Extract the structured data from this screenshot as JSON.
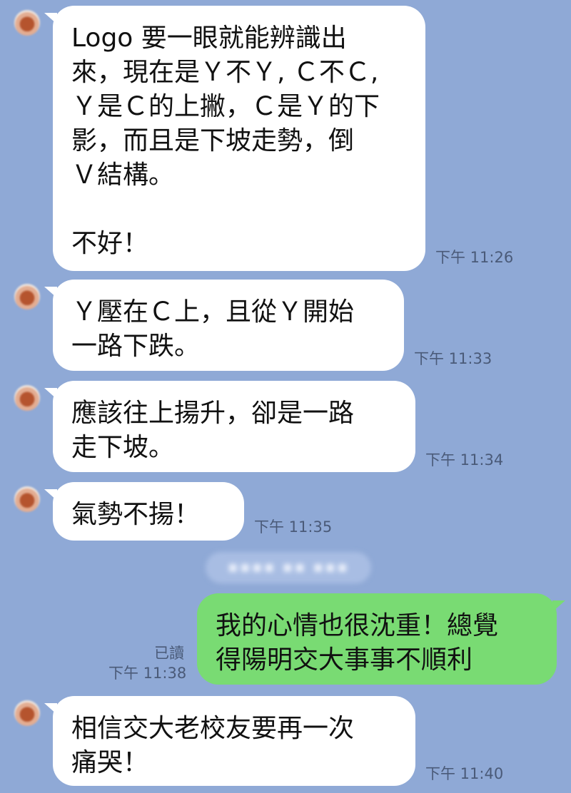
{
  "colors": {
    "background": "#8FA9D6",
    "incoming_bubble": "#ffffff",
    "outgoing_bubble": "#79DB73"
  },
  "messages": [
    {
      "text": "Logo 要一眼就能辨識出\n來，現在是Ｙ不Ｙ, Ｃ不Ｃ,\nＹ是Ｃ的上撇，Ｃ是Ｙ的下\n影，而且是下坡走勢，倒\nＶ結構。\n\n不好！",
      "time": "下午 11:26"
    },
    {
      "text": "Ｙ壓在Ｃ上，且從Ｙ開始\n一路下跌。",
      "time": "下午 11:33"
    },
    {
      "text": "應該往上揚升，卻是一路\n走下坡。",
      "time": "下午 11:34"
    },
    {
      "text": "氣勢不揚！",
      "time": "下午 11:35"
    },
    {
      "text": "我的心情也很沈重！總覺\n得陽明交大事事不順利",
      "time": "下午 11:38",
      "read": "已讀"
    },
    {
      "text": "相信交大老校友要再一次\n痛哭！",
      "time": "下午 11:40"
    }
  ]
}
